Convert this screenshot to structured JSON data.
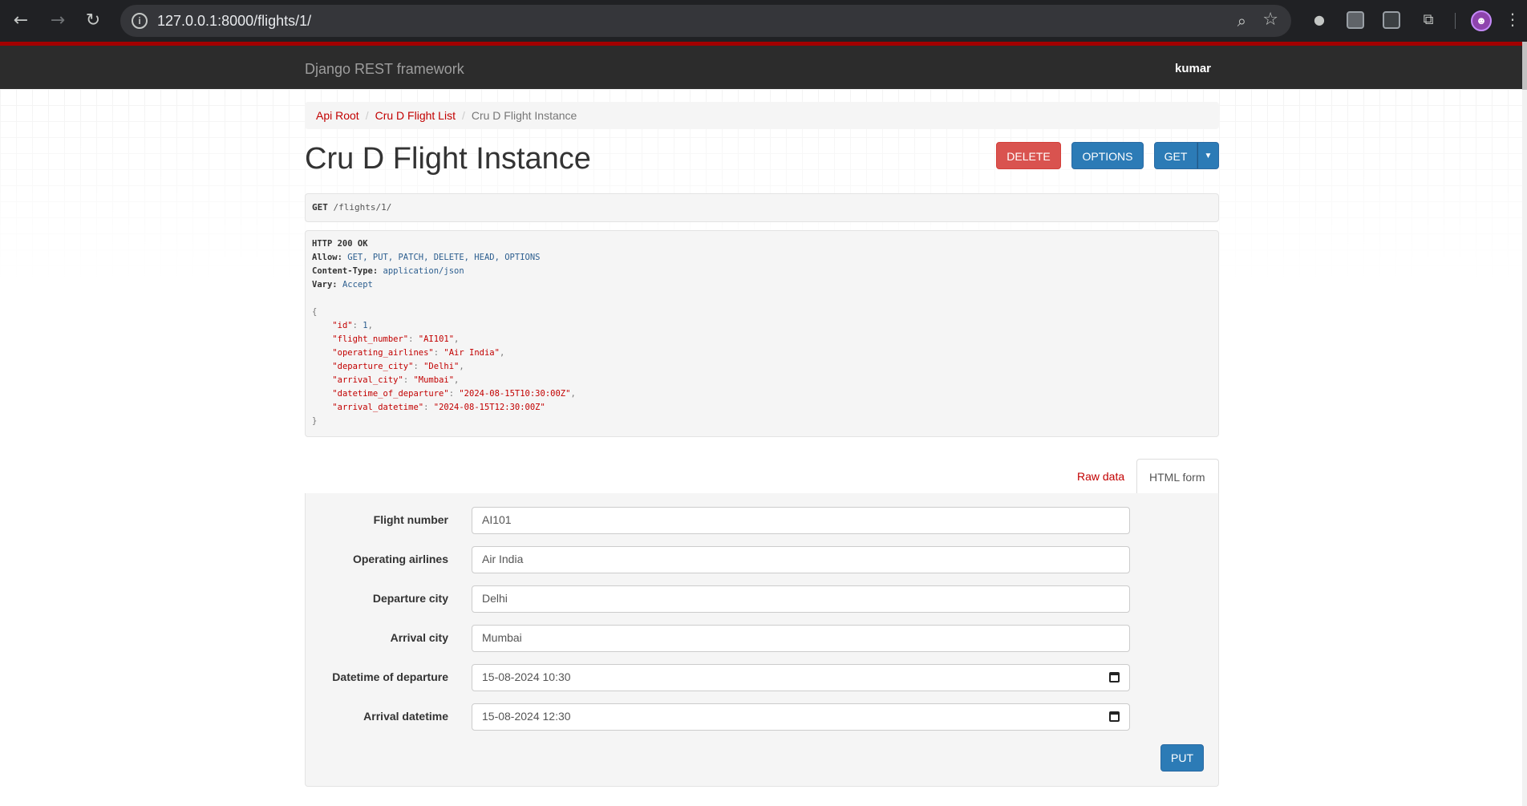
{
  "browser": {
    "url": "127.0.0.1:8000/flights/1/"
  },
  "navbar": {
    "brand": "Django REST framework",
    "user": "kumar"
  },
  "breadcrumb": {
    "items": [
      "Api Root",
      "Cru D Flight List",
      "Cru D Flight Instance"
    ]
  },
  "page": {
    "title": "Cru D Flight Instance",
    "buttons": {
      "delete": "DELETE",
      "options": "OPTIONS",
      "get": "GET"
    }
  },
  "request": {
    "method": "GET",
    "path": "/flights/1/"
  },
  "response": {
    "status": "HTTP 200 OK",
    "allow_key": "Allow:",
    "allow_value": "GET, PUT, PATCH, DELETE, HEAD, OPTIONS",
    "content_type_key": "Content-Type:",
    "content_type_value": "application/json",
    "vary_key": "Vary:",
    "vary_value": "Accept",
    "json": {
      "id": "1",
      "flight_number": "\"AI101\"",
      "operating_airlines": "\"Air India\"",
      "departure_city": "\"Delhi\"",
      "arrival_city": "\"Mumbai\"",
      "datetime_of_departure": "\"2024-08-15T10:30:00Z\"",
      "arrival_datetime": "\"2024-08-15T12:30:00Z\""
    }
  },
  "tabs": {
    "raw": "Raw data",
    "html": "HTML form"
  },
  "form": {
    "fields": [
      {
        "label": "Flight number",
        "value": "AI101"
      },
      {
        "label": "Operating airlines",
        "value": "Air India"
      },
      {
        "label": "Departure city",
        "value": "Delhi"
      },
      {
        "label": "Arrival city",
        "value": "Mumbai"
      },
      {
        "label": "Datetime of departure",
        "value": "15-08-2024 10:30"
      },
      {
        "label": "Arrival datetime",
        "value": "15-08-2024 12:30"
      }
    ],
    "submit": "PUT"
  },
  "colors": {
    "brand_red": "#a30000",
    "link_red": "#c20000",
    "primary_blue": "#2c7bb6",
    "danger_red": "#d9534f"
  }
}
